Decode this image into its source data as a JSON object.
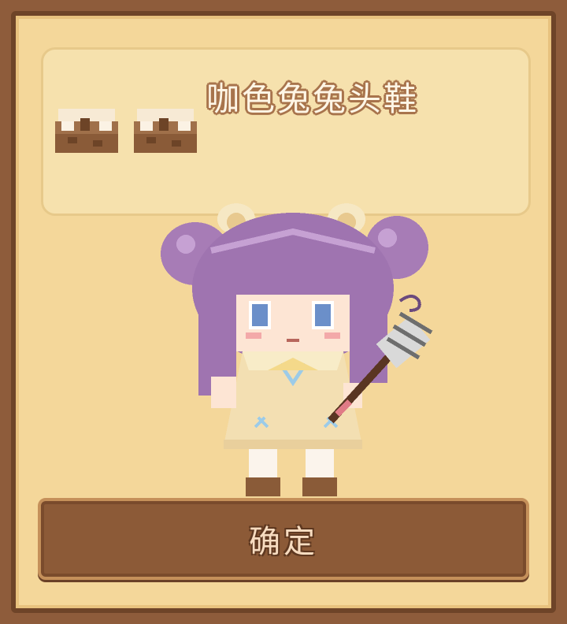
{
  "dialog": {
    "item_name": "咖色兔兔头鞋",
    "confirm_label": "确定"
  },
  "item": {
    "icon": "boot-icon",
    "pieces": 2
  },
  "colors": {
    "panel": "#f4d79a",
    "frame": "#6e4428",
    "button": "#8c5a37",
    "hair": "#a77cb6",
    "dress": "#f3dfb2"
  }
}
